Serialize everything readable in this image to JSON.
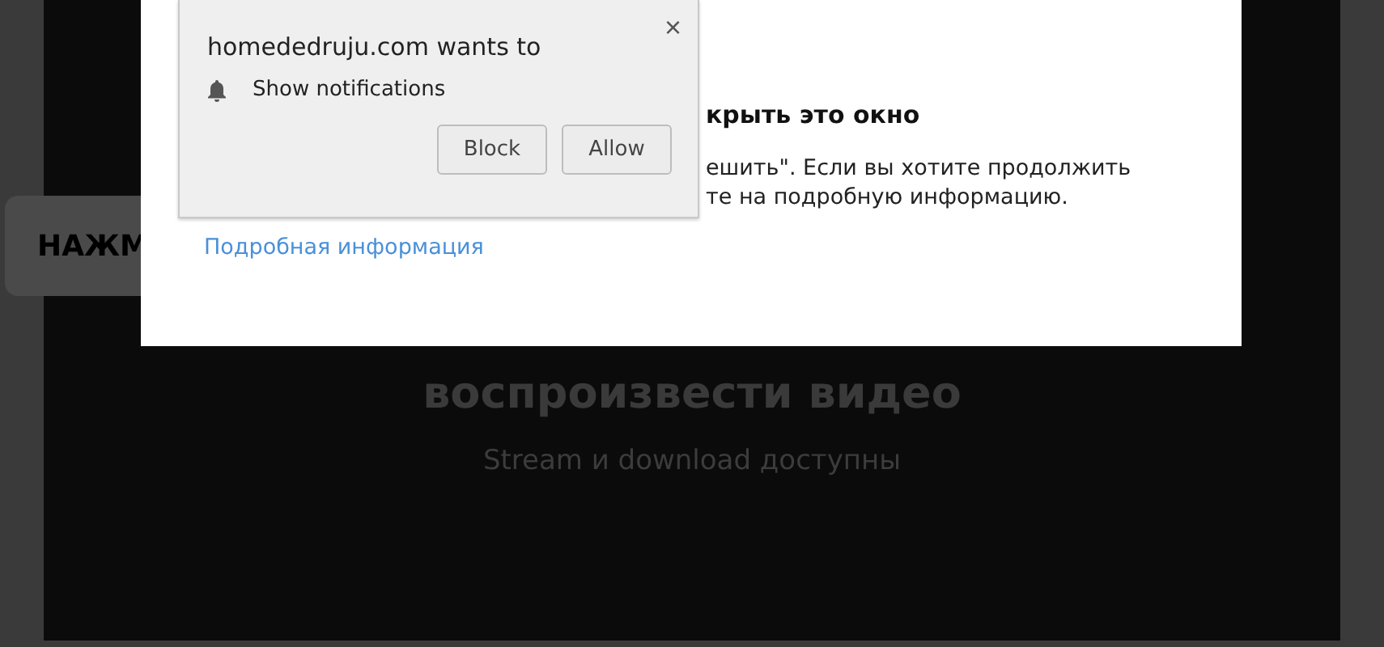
{
  "page": {
    "side_button": "НАЖМ",
    "headline": "воспроизвести видео",
    "subtitle": "Stream и download доступны"
  },
  "modal": {
    "title": "крыть это окно",
    "lines": [
      "ешить\". Если вы хотите продолжить",
      "те на подробную информацию."
    ],
    "link": "Подробная информация"
  },
  "permission_popup": {
    "title": "homededruju.com wants to",
    "close": "×",
    "permission": "Show notifications",
    "buttons": [
      "Block",
      "Allow"
    ]
  }
}
